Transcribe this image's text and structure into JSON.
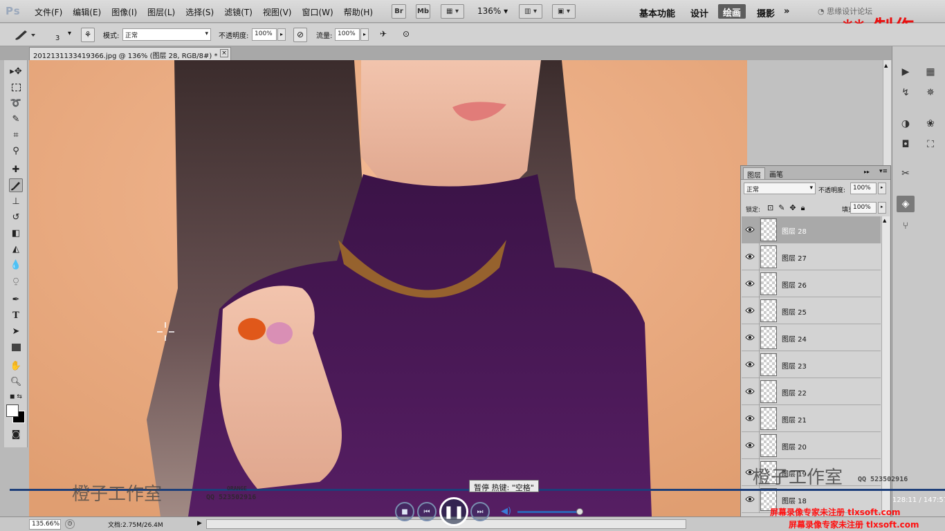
{
  "app": {
    "logo": "Ps"
  },
  "menu": [
    "文件(F)",
    "编辑(E)",
    "图像(I)",
    "图层(L)",
    "选择(S)",
    "滤镜(T)",
    "视图(V)",
    "窗口(W)",
    "帮助(H)"
  ],
  "menubar_buttons": {
    "br": "Br",
    "mb": "Mb",
    "zoom": "136%"
  },
  "workspaces": [
    "基本功能",
    "设计",
    "绘画",
    "摄影"
  ],
  "workspace_active": "绘画",
  "site_search": "思缘设计论坛",
  "watermark_top": "** 制作",
  "options": {
    "brush_size": "3",
    "mode_label": "模式:",
    "mode_value": "正常",
    "opacity_label": "不透明度:",
    "opacity_value": "100%",
    "flow_label": "流量:",
    "flow_value": "100%"
  },
  "document_tab": {
    "title": "2012131133419366.jpg @ 136% (图层 28, RGB/8#) *",
    "close": "×"
  },
  "layers_panel": {
    "tabs": [
      "图层",
      "画笔"
    ],
    "blend_mode": "正常",
    "opacity_label": "不透明度:",
    "opacity_value": "100%",
    "lock_label": "锁定:",
    "fill_label": "填充:",
    "fill_value": "100%",
    "layers": [
      {
        "name": "图层 28",
        "selected": true
      },
      {
        "name": "图层 27",
        "selected": false
      },
      {
        "name": "图层 26",
        "selected": false
      },
      {
        "name": "图层 25",
        "selected": false
      },
      {
        "name": "图层 24",
        "selected": false
      },
      {
        "name": "图层 23",
        "selected": false
      },
      {
        "name": "图层 22",
        "selected": false
      },
      {
        "name": "图层 21",
        "selected": false
      },
      {
        "name": "图层 20",
        "selected": false
      },
      {
        "name": "图层 19",
        "selected": false
      },
      {
        "name": "图层 18",
        "selected": false
      }
    ]
  },
  "status": {
    "zoom": "135.66%",
    "doc": "文档:2.75M/26.4M"
  },
  "player": {
    "tooltip": "暂停 热键: \"空格\"",
    "time": "128:11 / 147:57",
    "volume": 0.85,
    "progress": 0.87
  },
  "overlays": {
    "studio_name": "橙子工作室",
    "studio_sub": "ORANGE",
    "studio_qq": "QQ 523502916",
    "studio_sub_right": "QQ 523502916",
    "reg_text_1": "屏幕录像专家未注册 tlxsoft.com",
    "reg_text_2": "屏幕录像专家未注册 tlxsoft.com"
  }
}
